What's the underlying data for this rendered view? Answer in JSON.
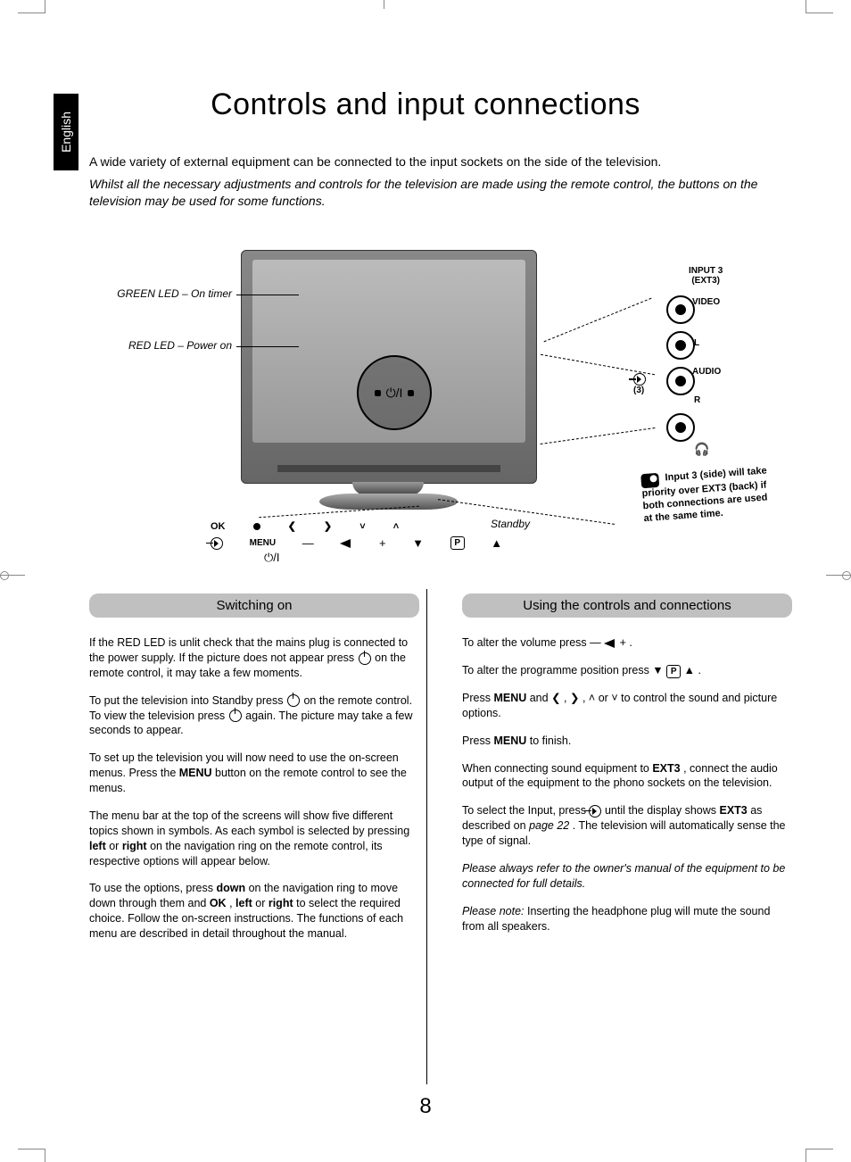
{
  "language_tab": "English",
  "page_title": "Controls and input connections",
  "intro": {
    "line1": "A wide variety of external equipment can be connected to the input sockets on the side of the television.",
    "line2_italic": "Whilst all the necessary adjustments and controls for the television are made using the remote control, the buttons on the television may be used for some functions."
  },
  "diagram": {
    "green_led": "GREEN LED – On timer",
    "red_led": "RED LED – Power on",
    "standby": "Standby",
    "input3_header": "INPUT 3\n(EXT3)",
    "jack_video": "VIDEO",
    "jack_L": "L",
    "jack_audio": "AUDIO",
    "jack_R": "R",
    "jack_hp": "◎",
    "src_num": "(3)",
    "note": {
      "text": "Input 3 (side) will take priority over EXT3 (back) if both connections are used at the same time."
    },
    "button_row": {
      "ok": "OK",
      "menu": "MENU"
    },
    "pw_text": "⏻/I"
  },
  "left_section": {
    "heading": "Switching on",
    "p1a": "If the RED LED is unlit check that the mains plug is connected to the power supply. If the picture does not appear press ",
    "p1b": " on the remote control, it may take a few moments.",
    "p2a": "To put the television into Standby press ",
    "p2b": " on the remote control. To view the television press ",
    "p2c": " again. The picture may take a few seconds to appear.",
    "p3a": "To set up the television you will now need to use the on-screen menus. Press the ",
    "p3_menu": "MENU",
    "p3b": " button on the remote control to see the menus.",
    "p4a": "The menu bar at the top of the screens will show five different topics shown in symbols. As each symbol is selected by pressing ",
    "p4_left": "left",
    "p4_or1": " or ",
    "p4_right": "right",
    "p4b": " on the navigation ring on the remote control, its respective options will appear below.",
    "p5a": "To use the options, press ",
    "p5_down": "down",
    "p5b": " on the navigation ring to move down through them and ",
    "p5_ok": "OK",
    "p5c": ", ",
    "p5_left": "left",
    "p5_or2": " or ",
    "p5_right": "right",
    "p5d": " to select the required choice. Follow the on-screen instructions. The functions of each menu are described in detail throughout the manual."
  },
  "right_section": {
    "heading": "Using the controls and connections",
    "p1a": "To alter the volume press ",
    "p1_sym": "— ◢ +",
    "p1b": ".",
    "p2a": "To alter the programme position press ",
    "p2_down": "▼",
    "p2_p": "P",
    "p2_up": "▲",
    "p2b": ".",
    "p3a": "Press ",
    "p3_menu": "MENU",
    "p3b": " and ",
    "p3_l": "❮",
    "p3c": ", ",
    "p3_r": "❯",
    "p3d": ", ",
    "p3_u": "˄",
    "p3e": " or ",
    "p3_dn": "˅",
    "p3f": " to control the sound and picture options.",
    "p4a": "Press ",
    "p4_menu": "MENU",
    "p4b": " to finish.",
    "p5a": "When connecting sound equipment to ",
    "p5_ext3": "EXT3",
    "p5b": ", connect the audio output of the equipment to the phono sockets on the television.",
    "p6a": "To select the Input, press ",
    "p6b": " until the display shows ",
    "p6_ext3": "EXT3",
    "p6c": " as described on ",
    "p6_page": "page 22",
    "p6d": ". The television will automatically sense the type of signal.",
    "p7_italic": "Please always refer to the owner's manual of the equipment to be connected for full details.",
    "p8a_italic": "Please note:",
    "p8b": " Inserting the headphone plug will mute the sound from all speakers."
  },
  "page_number": "8"
}
